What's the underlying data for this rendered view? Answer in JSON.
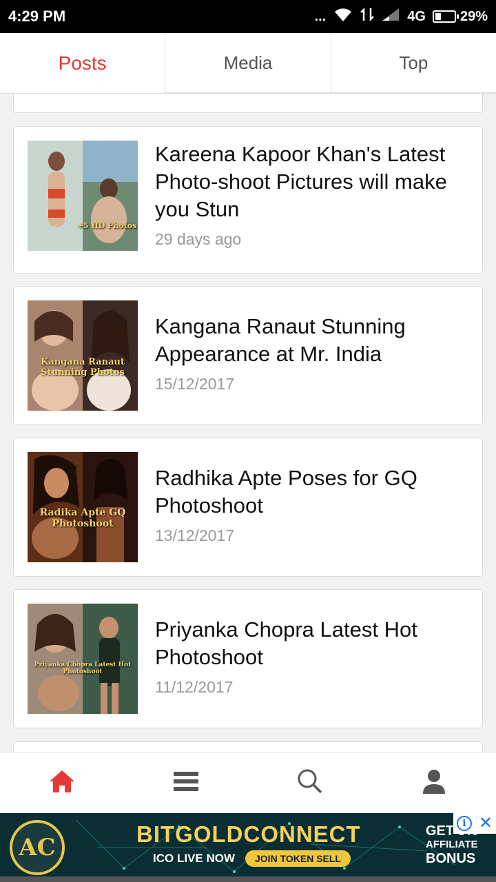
{
  "status_bar": {
    "time": "4:29 PM",
    "dots": "...",
    "network": "4G",
    "battery": "29%"
  },
  "tabs": [
    {
      "label": "Posts",
      "active": true
    },
    {
      "label": "Media",
      "active": false
    },
    {
      "label": "Top",
      "active": false
    }
  ],
  "posts": [
    {
      "title": "Kareena Kapoor Khan's Latest Photo-shoot Pictures will make you Stun",
      "date": "29 days ago",
      "thumb_caption": "+5 HD Photos"
    },
    {
      "title": "Kangana Ranaut Stunning Appearance at Mr. India",
      "date": "15/12/2017",
      "thumb_caption": "Kangana Ranaut Stunning Photos"
    },
    {
      "title": "Radhika Apte Poses for GQ Photoshoot",
      "date": "13/12/2017",
      "thumb_caption": "Radika Apte GQ Photoshoot"
    },
    {
      "title": "Priyanka Chopra Latest Hot Photoshoot",
      "date": "11/12/2017",
      "thumb_caption": "Priyanka Chopra Latest Hot Photoshoot"
    }
  ],
  "bottom_nav": {
    "icons": [
      "home-icon",
      "menu-icon",
      "search-icon",
      "profile-icon"
    ],
    "active_color": "#e53935",
    "inactive_color": "#555555"
  },
  "ad": {
    "logo_text": "AC",
    "title": "BITGOLDCONNECT",
    "ico_text": "ICO LIVE NOW",
    "join_text": "JOIN TOKEN SELL",
    "get_text": "GET 5%",
    "affiliate_text": "AFFILIATE",
    "bonus_text": "BONUS"
  },
  "colors": {
    "accent": "#e53935",
    "ad_gold": "#f4d15a"
  }
}
